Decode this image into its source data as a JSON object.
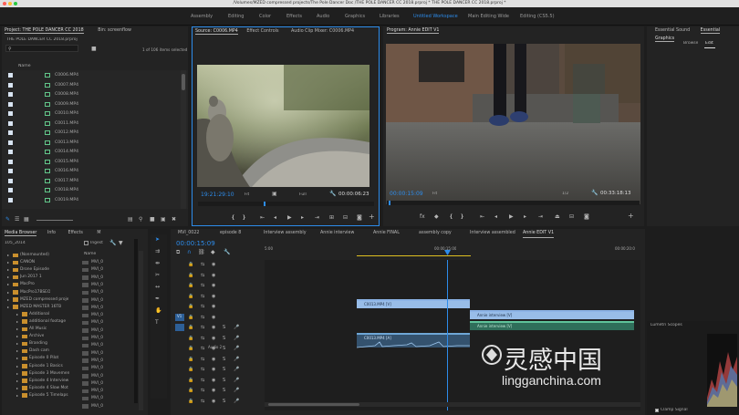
{
  "window": {
    "title": "/Volumes/MZED compressed projects/The Pole Dancer Doc /THE POLE DANCER CC 2018.prproj * THE POLE DANCER CC 2018.prproj *"
  },
  "workspaces": {
    "tabs": [
      "Assembly",
      "Editing",
      "Color",
      "Effects",
      "Audio",
      "Graphics",
      "Libraries",
      "Untitled Workspace",
      "Main Editing Wide",
      "Editing (CS5.5)"
    ],
    "active": "Untitled Workspace"
  },
  "project_panel": {
    "tab_project": "Project: THE POLE DANCER CC 2018",
    "tab_bin": "Bin: screenflow",
    "project_file": "THE POLE DANCER CC 2018.prproj",
    "items_selected": "1 of 106 items selected",
    "column_name": "Name",
    "items": [
      "C0006.MP4",
      "C0007.MP4",
      "C0008.MP4",
      "C0009.MP4",
      "C0010.MP4",
      "C0011.MP4",
      "C0012.MP4",
      "C0013.MP4",
      "C0014.MP4",
      "C0015.MP4",
      "C0016.MP4",
      "C0017.MP4",
      "C0018.MP4",
      "C0019.MP4"
    ]
  },
  "source_monitor": {
    "tab_source": "Source: C0006.MP4",
    "tab_effects": "Effect Controls",
    "tab_mixer": "Audio Clip Mixer: C0006.MP4",
    "timecode_in": "19:21:29:10",
    "fit_label": "Fit",
    "quality_label": "Full",
    "duration": "00:00:06:23"
  },
  "program_monitor": {
    "tab": "Program: Annie EDIT V1",
    "timecode": "00:00:15:09",
    "fit_label": "Fit",
    "zoom_label": "1/2",
    "duration": "00:33:18:13"
  },
  "essential": {
    "tab_sound": "Essential Sound",
    "tab_graphics": "Essential Graphics",
    "browse": "Browse",
    "edit": "Edit"
  },
  "media_browser": {
    "tab_media": "Media Browser",
    "tab_info": "Info",
    "tab_effects": "Effects",
    "tab_m": "M",
    "drive": "105_2014",
    "ingest_label": "Ingest",
    "column_name": "Name",
    "folders": [
      "(Nonmounted)",
      "CANON",
      "Drone Episode",
      "Jun 2017 1",
      "MacPro",
      "MacPro17BSEO",
      "MZED compressed proje",
      "MZED MASTER 16TB",
      "Additional",
      "additional footage",
      "All Music",
      "Archive",
      "Branding",
      "Dash cam",
      "Episode 0 Pilot",
      "Episode 1 Basics",
      "Episode 3 Movemen",
      "Episode 4 Interview",
      "Episode 4 Slow Mot",
      "Episode 5 Timelaps"
    ],
    "files": [
      "MVI_0",
      "MVI_0",
      "MVI_0",
      "MVI_0",
      "MVI_0",
      "MVI_0",
      "MVI_0",
      "MVI_0",
      "MVI_0",
      "MVI_0",
      "MVI_0",
      "MVI_0",
      "MVI_0",
      "MVI_0",
      "MVI_0",
      "MVI_0",
      "MVI_0",
      "MVI_0",
      "MVI_0",
      "MVI_0"
    ]
  },
  "timeline": {
    "tabs": [
      "MVI_0022",
      "episode 8",
      "Interview assembly",
      "Annie interview",
      "Annie FINAL",
      "assembly copy",
      "Interview assembled",
      "Annie EDIT V1"
    ],
    "active_tab": "Annie EDIT V1",
    "timecode": "00:00:15:09",
    "ruler": [
      "5:00",
      "00:00:15:00",
      "00:00:20:0"
    ],
    "v_track": "V1",
    "a_track": "Audio 2",
    "clips": {
      "video1": "C0013.MP4 [V]",
      "video2": "Annie interview [V]",
      "video3": "Annie interview [V]",
      "audio1": "C0013.MP4 [A]"
    }
  },
  "lumetri": {
    "title": "Lumetri Scopes",
    "clamp": "Clamp Signal"
  },
  "watermark": {
    "cn": "灵感中国",
    "url": "lingganchina.com"
  }
}
